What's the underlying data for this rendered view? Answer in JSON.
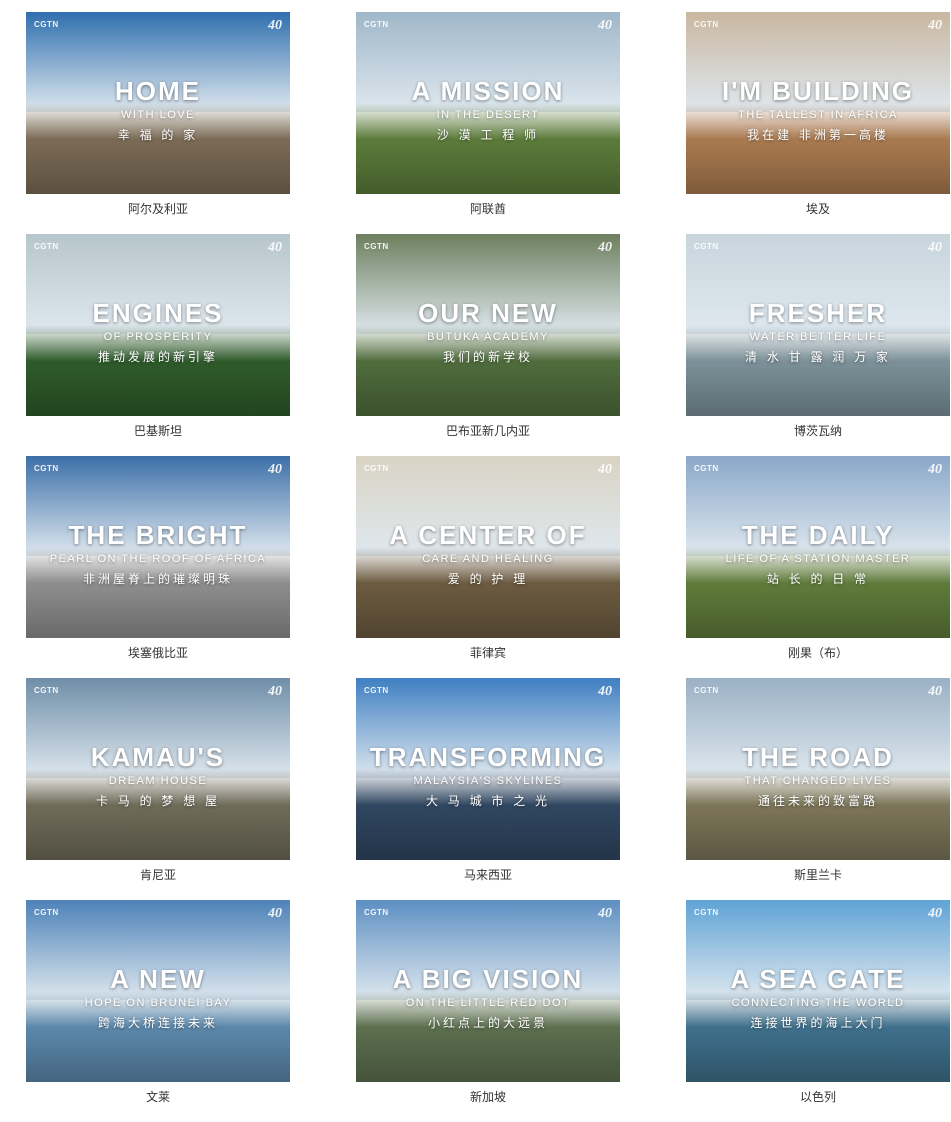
{
  "cards": [
    {
      "caption": "阿尔及利亚",
      "title": "HOME",
      "subtitle": "WITH LOVE",
      "cn": "幸 福 的 家",
      "sky": "#2f6fae",
      "ground": "#7a6a55"
    },
    {
      "caption": "阿联酋",
      "title": "A MISSION",
      "subtitle": "IN THE DESERT",
      "cn": "沙 漠 工 程 师",
      "sky": "#9fb7c9",
      "ground": "#5b7a3a"
    },
    {
      "caption": "埃及",
      "title": "I'M BUILDING",
      "subtitle": "THE TALLEST IN AFRICA",
      "cn": "我在建 非洲第一高楼",
      "sky": "#c9b7a0",
      "ground": "#a8794f"
    },
    {
      "caption": "巴基斯坦",
      "title": "ENGINES",
      "subtitle": "OF PROSPERITY",
      "cn": "推动发展的新引擎",
      "sky": "#b7c6cc",
      "ground": "#2e5a2a"
    },
    {
      "caption": "巴布亚新几内亚",
      "title": "OUR NEW",
      "subtitle": "BUTUKA ACADEMY",
      "cn": "我们的新学校",
      "sky": "#6d7f5e",
      "ground": "#4f6b3c"
    },
    {
      "caption": "博茨瓦纳",
      "title": "FRESHER",
      "subtitle": "WATER BETTER LIFE",
      "cn": "清 水 甘 露 润 万 家",
      "sky": "#c8d5dc",
      "ground": "#7a8f97"
    },
    {
      "caption": "埃塞俄比亚",
      "title": "THE BRIGHT",
      "subtitle": "PEARL ON THE ROOF OF AFRICA",
      "cn": "非洲屋脊上的璀璨明珠",
      "sky": "#3c6fa8",
      "ground": "#8c8c8c"
    },
    {
      "caption": "菲律宾",
      "title": "A CENTER OF",
      "subtitle": "CARE AND HEALING",
      "cn": "爱 的 护 理",
      "sky": "#d9d3c4",
      "ground": "#6b5a40"
    },
    {
      "caption": "刚果（布）",
      "title": "THE DAILY",
      "subtitle": "LIFE OF A STATION MASTER",
      "cn": "站 长 的 日 常",
      "sky": "#8aa7c9",
      "ground": "#5e7a3a"
    },
    {
      "caption": "肯尼亚",
      "title": "KAMAU'S",
      "subtitle": "DREAM HOUSE",
      "cn": "卡 马 的 梦 想 屋",
      "sky": "#6f8ea8",
      "ground": "#6d6a58"
    },
    {
      "caption": "马来西亚",
      "title": "TRANSFORMING",
      "subtitle": "MALAYSIA'S SKYLINES",
      "cn": "大 马 城 市 之 光",
      "sky": "#3f7fc2",
      "ground": "#2f4660"
    },
    {
      "caption": "斯里兰卡",
      "title": "THE ROAD",
      "subtitle": "THAT CHANGED LIVES",
      "cn": "通往未来的致富路",
      "sky": "#9ab0c4",
      "ground": "#7b7458"
    },
    {
      "caption": "文莱",
      "title": "A NEW",
      "subtitle": "HOPE ON BRUNEI BAY",
      "cn": "跨海大桥连接未来",
      "sky": "#4d82b8",
      "ground": "#5a86a9"
    },
    {
      "caption": "新加坡",
      "title": "A BIG VISION",
      "subtitle": "ON THE LITTLE RED DOT",
      "cn": "小红点上的大远景",
      "sky": "#5d8fc2",
      "ground": "#5b6e4e"
    },
    {
      "caption": "以色列",
      "title": "A SEA GATE",
      "subtitle": "CONNECTING THE WORLD",
      "cn": "连接世界的海上大门",
      "sky": "#5fa3d6",
      "ground": "#3e6f8a"
    }
  ],
  "brand": {
    "name": "CGTN",
    "badge": "40"
  }
}
